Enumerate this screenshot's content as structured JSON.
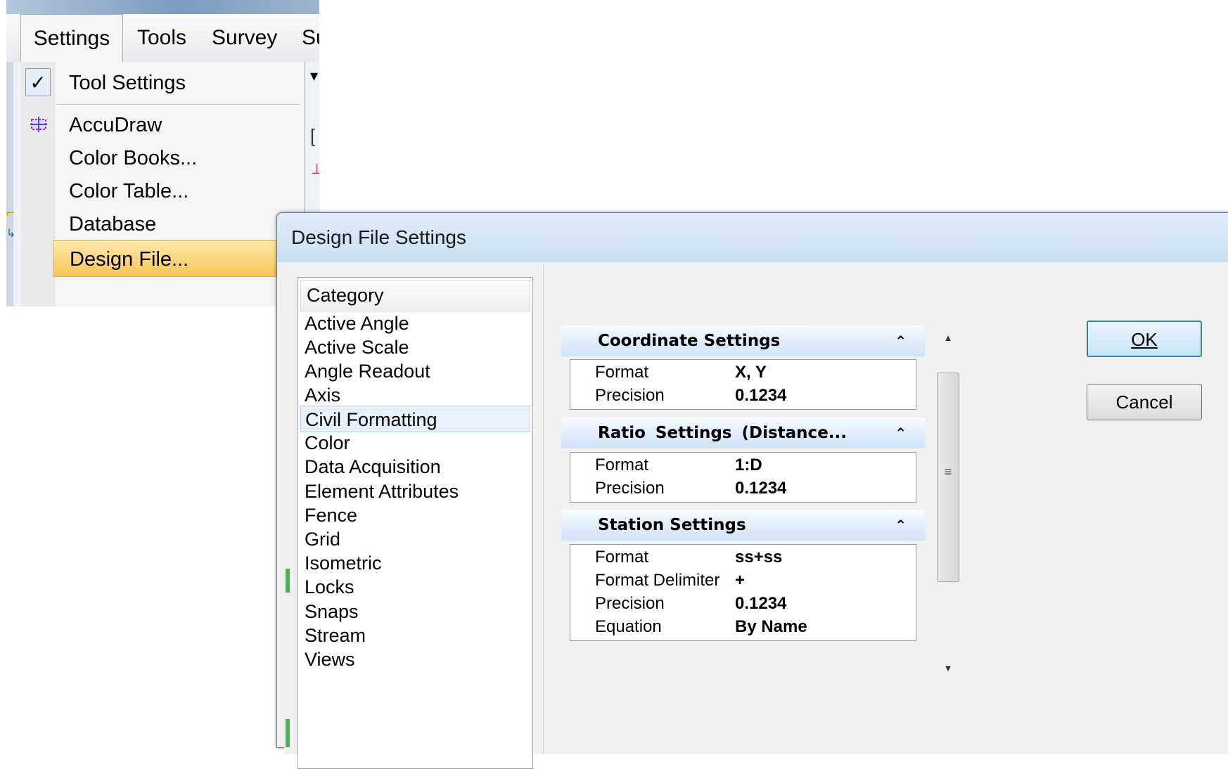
{
  "menubar": {
    "items": [
      {
        "label": "Settings"
      },
      {
        "label": "Tools"
      },
      {
        "label": "Survey"
      },
      {
        "label": "Su"
      }
    ]
  },
  "settings_menu": {
    "items": [
      {
        "label": "Tool Settings",
        "checked": true
      },
      {
        "label": "AccuDraw",
        "icon": "accudraw-icon"
      },
      {
        "label": "Color Books..."
      },
      {
        "label": "Color Table..."
      },
      {
        "label": "Database"
      },
      {
        "label": "Design File...",
        "highlighted": true
      }
    ]
  },
  "dialog": {
    "title": "Design File Settings",
    "category_header": "Category",
    "categories": [
      "Active Angle",
      "Active Scale",
      "Angle Readout",
      "Axis",
      "Civil Formatting",
      "Color",
      "Data Acquisition",
      "Element Attributes",
      "Fence",
      "Grid",
      "Isometric",
      "Locks",
      "Snaps",
      "Stream",
      "Views"
    ],
    "selected_category": "Civil Formatting",
    "sections": [
      {
        "title": "Coordinate Settings",
        "rows": [
          {
            "label": "Format",
            "value": "X, Y"
          },
          {
            "label": "Precision",
            "value": "0.1234"
          }
        ]
      },
      {
        "title": "Ratio  Settings  (Distance...",
        "rows": [
          {
            "label": "Format",
            "value": "1:D"
          },
          {
            "label": "Precision",
            "value": "0.1234"
          }
        ]
      },
      {
        "title": "Station Settings",
        "rows": [
          {
            "label": "Format",
            "value": "ss+ss"
          },
          {
            "label": "Format Delimiter",
            "value": "+"
          },
          {
            "label": "Precision",
            "value": "0.1234"
          },
          {
            "label": "Equation",
            "value": "By Name"
          }
        ]
      }
    ],
    "buttons": {
      "ok": "OK",
      "cancel": "Cancel"
    }
  },
  "colors": {
    "menu_highlight": "#f7c55a",
    "dialog_title_bg": "#c9def2",
    "selection_bg": "#e8f1fb",
    "ok_button_border": "#3c7fb1"
  }
}
